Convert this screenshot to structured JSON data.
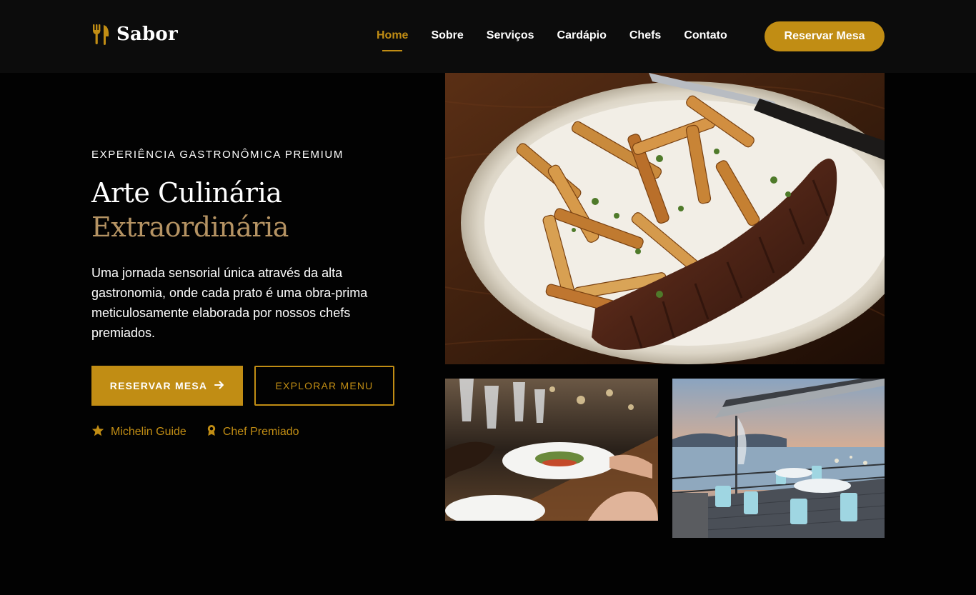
{
  "brand": {
    "name": "Sabor",
    "icon": "utensils-icon",
    "accent_color": "#c18d14",
    "secondary_gold": "#b59363"
  },
  "nav": {
    "items": [
      {
        "label": "Home",
        "active": true
      },
      {
        "label": "Sobre",
        "active": false
      },
      {
        "label": "Serviços",
        "active": false
      },
      {
        "label": "Cardápio",
        "active": false
      },
      {
        "label": "Chefs",
        "active": false
      },
      {
        "label": "Contato",
        "active": false
      }
    ],
    "cta_label": "Reservar Mesa"
  },
  "hero": {
    "eyebrow": "EXPERIÊNCIA GASTRONÔMICA PREMIUM",
    "title_line1": "Arte Culinária",
    "title_line2": "Extraordinária",
    "description": "Uma jornada sensorial única através da alta gastronomia, onde cada prato é uma obra-prima meticulosamente elaborada por nossos chefs premiados.",
    "primary_button": {
      "label": "RESERVAR MESA",
      "icon": "arrow-right-icon"
    },
    "secondary_button": {
      "label": "EXPLORAR MENU"
    },
    "badges": [
      {
        "label": "Michelin Guide",
        "icon": "star-icon"
      },
      {
        "label": "Chef Premiado",
        "icon": "award-icon"
      }
    ]
  },
  "images": {
    "main": {
      "subject": "steak-and-fries-plate"
    },
    "small_left": {
      "subject": "fine-dining-table"
    },
    "small_right": {
      "subject": "waterfront-terrace"
    }
  }
}
